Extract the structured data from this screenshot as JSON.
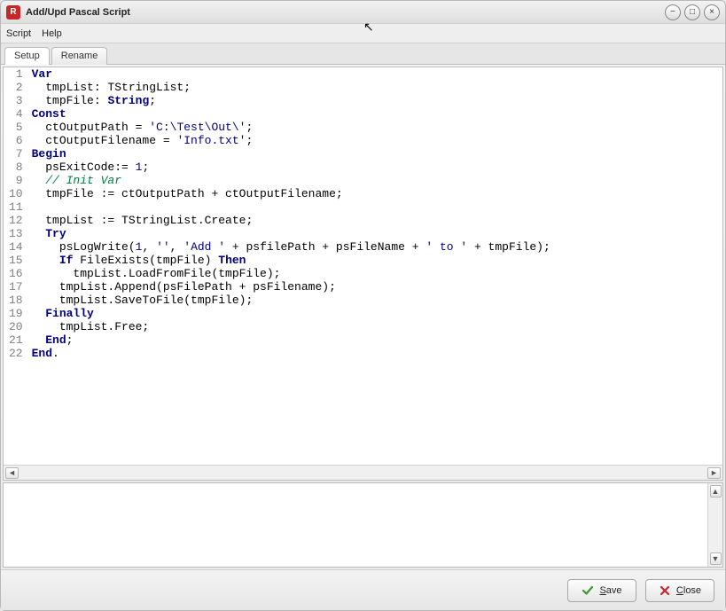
{
  "window": {
    "title": "Add/Upd Pascal Script"
  },
  "menubar": {
    "script": "Script",
    "help": "Help"
  },
  "tabs": {
    "setup": "Setup",
    "rename": "Rename"
  },
  "footer": {
    "save": "Save",
    "close": "Close"
  },
  "code": {
    "lines": [
      {
        "n": "1",
        "seg": [
          {
            "t": "Var",
            "c": "kw"
          }
        ]
      },
      {
        "n": "2",
        "seg": [
          {
            "t": "  tmpList: TStringList;",
            "c": ""
          }
        ]
      },
      {
        "n": "3",
        "seg": [
          {
            "t": "  tmpFile: ",
            "c": ""
          },
          {
            "t": "String",
            "c": "kw"
          },
          {
            "t": ";",
            "c": ""
          }
        ]
      },
      {
        "n": "4",
        "seg": [
          {
            "t": "Const",
            "c": "kw"
          }
        ]
      },
      {
        "n": "5",
        "seg": [
          {
            "t": "  ctOutputPath = ",
            "c": ""
          },
          {
            "t": "'C:\\Test\\Out\\'",
            "c": "str"
          },
          {
            "t": ";",
            "c": ""
          }
        ]
      },
      {
        "n": "6",
        "seg": [
          {
            "t": "  ctOutputFilename = ",
            "c": ""
          },
          {
            "t": "'Info.txt'",
            "c": "str"
          },
          {
            "t": ";",
            "c": ""
          }
        ]
      },
      {
        "n": "7",
        "seg": [
          {
            "t": "Begin",
            "c": "kw"
          }
        ]
      },
      {
        "n": "8",
        "seg": [
          {
            "t": "  psExitCode:= ",
            "c": ""
          },
          {
            "t": "1",
            "c": "str"
          },
          {
            "t": ";",
            "c": ""
          }
        ]
      },
      {
        "n": "9",
        "seg": [
          {
            "t": "  ",
            "c": ""
          },
          {
            "t": "// Init Var",
            "c": "cm"
          }
        ]
      },
      {
        "n": "10",
        "seg": [
          {
            "t": "  tmpFile := ctOutputPath + ctOutputFilename;",
            "c": ""
          }
        ]
      },
      {
        "n": "11",
        "seg": [
          {
            "t": "",
            "c": ""
          }
        ]
      },
      {
        "n": "12",
        "seg": [
          {
            "t": "  tmpList := TStringList.Create;",
            "c": ""
          }
        ]
      },
      {
        "n": "13",
        "seg": [
          {
            "t": "  ",
            "c": ""
          },
          {
            "t": "Try",
            "c": "kw"
          }
        ]
      },
      {
        "n": "14",
        "seg": [
          {
            "t": "    psLogWrite(",
            "c": ""
          },
          {
            "t": "1",
            "c": "str"
          },
          {
            "t": ", ",
            "c": ""
          },
          {
            "t": "''",
            "c": "str"
          },
          {
            "t": ", ",
            "c": ""
          },
          {
            "t": "'Add '",
            "c": "str"
          },
          {
            "t": " + psfilePath + psFileName + ",
            "c": ""
          },
          {
            "t": "' to '",
            "c": "str"
          },
          {
            "t": " + tmpFile);",
            "c": ""
          }
        ]
      },
      {
        "n": "15",
        "seg": [
          {
            "t": "    ",
            "c": ""
          },
          {
            "t": "If",
            "c": "kw"
          },
          {
            "t": " FileExists(tmpFile) ",
            "c": ""
          },
          {
            "t": "Then",
            "c": "kw"
          }
        ]
      },
      {
        "n": "16",
        "seg": [
          {
            "t": "      tmpList.LoadFromFile(tmpFile);",
            "c": ""
          }
        ]
      },
      {
        "n": "17",
        "seg": [
          {
            "t": "    tmpList.Append(psFilePath + psFilename);",
            "c": ""
          }
        ]
      },
      {
        "n": "18",
        "seg": [
          {
            "t": "    tmpList.SaveToFile(tmpFile);",
            "c": ""
          }
        ]
      },
      {
        "n": "19",
        "seg": [
          {
            "t": "  ",
            "c": ""
          },
          {
            "t": "Finally",
            "c": "kw"
          }
        ]
      },
      {
        "n": "20",
        "seg": [
          {
            "t": "    tmpList.Free;",
            "c": ""
          }
        ]
      },
      {
        "n": "21",
        "seg": [
          {
            "t": "  ",
            "c": ""
          },
          {
            "t": "End",
            "c": "kw"
          },
          {
            "t": ";",
            "c": ""
          }
        ]
      },
      {
        "n": "22",
        "seg": [
          {
            "t": "End",
            "c": "kw"
          },
          {
            "t": ".",
            "c": ""
          }
        ]
      }
    ]
  }
}
